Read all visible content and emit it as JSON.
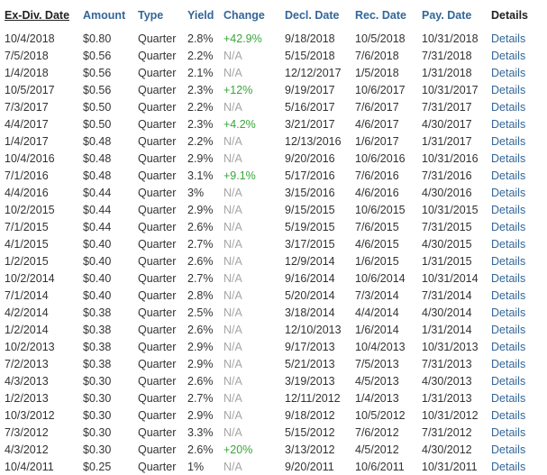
{
  "headers": {
    "ex_date": "Ex-Div. Date",
    "amount": "Amount",
    "type": "Type",
    "yield": "Yield",
    "change": "Change",
    "decl_date": "Decl. Date",
    "rec_date": "Rec. Date",
    "pay_date": "Pay. Date",
    "details": "Details"
  },
  "rows": [
    {
      "ex_date": "10/4/2018",
      "amount": "$0.80",
      "type": "Quarter",
      "yield": "2.8%",
      "change": "+42.9%",
      "decl_date": "9/18/2018",
      "rec_date": "10/5/2018",
      "pay_date": "10/31/2018",
      "details": "Details"
    },
    {
      "ex_date": "7/5/2018",
      "amount": "$0.56",
      "type": "Quarter",
      "yield": "2.2%",
      "change": "N/A",
      "decl_date": "5/15/2018",
      "rec_date": "7/6/2018",
      "pay_date": "7/31/2018",
      "details": "Details"
    },
    {
      "ex_date": "1/4/2018",
      "amount": "$0.56",
      "type": "Quarter",
      "yield": "2.1%",
      "change": "N/A",
      "decl_date": "12/12/2017",
      "rec_date": "1/5/2018",
      "pay_date": "1/31/2018",
      "details": "Details"
    },
    {
      "ex_date": "10/5/2017",
      "amount": "$0.56",
      "type": "Quarter",
      "yield": "2.3%",
      "change": "+12%",
      "decl_date": "9/19/2017",
      "rec_date": "10/6/2017",
      "pay_date": "10/31/2017",
      "details": "Details"
    },
    {
      "ex_date": "7/3/2017",
      "amount": "$0.50",
      "type": "Quarter",
      "yield": "2.2%",
      "change": "N/A",
      "decl_date": "5/16/2017",
      "rec_date": "7/6/2017",
      "pay_date": "7/31/2017",
      "details": "Details"
    },
    {
      "ex_date": "4/4/2017",
      "amount": "$0.50",
      "type": "Quarter",
      "yield": "2.3%",
      "change": "+4.2%",
      "decl_date": "3/21/2017",
      "rec_date": "4/6/2017",
      "pay_date": "4/30/2017",
      "details": "Details"
    },
    {
      "ex_date": "1/4/2017",
      "amount": "$0.48",
      "type": "Quarter",
      "yield": "2.2%",
      "change": "N/A",
      "decl_date": "12/13/2016",
      "rec_date": "1/6/2017",
      "pay_date": "1/31/2017",
      "details": "Details"
    },
    {
      "ex_date": "10/4/2016",
      "amount": "$0.48",
      "type": "Quarter",
      "yield": "2.9%",
      "change": "N/A",
      "decl_date": "9/20/2016",
      "rec_date": "10/6/2016",
      "pay_date": "10/31/2016",
      "details": "Details"
    },
    {
      "ex_date": "7/1/2016",
      "amount": "$0.48",
      "type": "Quarter",
      "yield": "3.1%",
      "change": "+9.1%",
      "decl_date": "5/17/2016",
      "rec_date": "7/6/2016",
      "pay_date": "7/31/2016",
      "details": "Details"
    },
    {
      "ex_date": "4/4/2016",
      "amount": "$0.44",
      "type": "Quarter",
      "yield": "3%",
      "change": "N/A",
      "decl_date": "3/15/2016",
      "rec_date": "4/6/2016",
      "pay_date": "4/30/2016",
      "details": "Details"
    },
    {
      "ex_date": "10/2/2015",
      "amount": "$0.44",
      "type": "Quarter",
      "yield": "2.9%",
      "change": "N/A",
      "decl_date": "9/15/2015",
      "rec_date": "10/6/2015",
      "pay_date": "10/31/2015",
      "details": "Details"
    },
    {
      "ex_date": "7/1/2015",
      "amount": "$0.44",
      "type": "Quarter",
      "yield": "2.6%",
      "change": "N/A",
      "decl_date": "5/19/2015",
      "rec_date": "7/6/2015",
      "pay_date": "7/31/2015",
      "details": "Details"
    },
    {
      "ex_date": "4/1/2015",
      "amount": "$0.40",
      "type": "Quarter",
      "yield": "2.7%",
      "change": "N/A",
      "decl_date": "3/17/2015",
      "rec_date": "4/6/2015",
      "pay_date": "4/30/2015",
      "details": "Details"
    },
    {
      "ex_date": "1/2/2015",
      "amount": "$0.40",
      "type": "Quarter",
      "yield": "2.6%",
      "change": "N/A",
      "decl_date": "12/9/2014",
      "rec_date": "1/6/2015",
      "pay_date": "1/31/2015",
      "details": "Details"
    },
    {
      "ex_date": "10/2/2014",
      "amount": "$0.40",
      "type": "Quarter",
      "yield": "2.7%",
      "change": "N/A",
      "decl_date": "9/16/2014",
      "rec_date": "10/6/2014",
      "pay_date": "10/31/2014",
      "details": "Details"
    },
    {
      "ex_date": "7/1/2014",
      "amount": "$0.40",
      "type": "Quarter",
      "yield": "2.8%",
      "change": "N/A",
      "decl_date": "5/20/2014",
      "rec_date": "7/3/2014",
      "pay_date": "7/31/2014",
      "details": "Details"
    },
    {
      "ex_date": "4/2/2014",
      "amount": "$0.38",
      "type": "Quarter",
      "yield": "2.5%",
      "change": "N/A",
      "decl_date": "3/18/2014",
      "rec_date": "4/4/2014",
      "pay_date": "4/30/2014",
      "details": "Details"
    },
    {
      "ex_date": "1/2/2014",
      "amount": "$0.38",
      "type": "Quarter",
      "yield": "2.6%",
      "change": "N/A",
      "decl_date": "12/10/2013",
      "rec_date": "1/6/2014",
      "pay_date": "1/31/2014",
      "details": "Details"
    },
    {
      "ex_date": "10/2/2013",
      "amount": "$0.38",
      "type": "Quarter",
      "yield": "2.9%",
      "change": "N/A",
      "decl_date": "9/17/2013",
      "rec_date": "10/4/2013",
      "pay_date": "10/31/2013",
      "details": "Details"
    },
    {
      "ex_date": "7/2/2013",
      "amount": "$0.38",
      "type": "Quarter",
      "yield": "2.9%",
      "change": "N/A",
      "decl_date": "5/21/2013",
      "rec_date": "7/5/2013",
      "pay_date": "7/31/2013",
      "details": "Details"
    },
    {
      "ex_date": "4/3/2013",
      "amount": "$0.30",
      "type": "Quarter",
      "yield": "2.6%",
      "change": "N/A",
      "decl_date": "3/19/2013",
      "rec_date": "4/5/2013",
      "pay_date": "4/30/2013",
      "details": "Details"
    },
    {
      "ex_date": "1/2/2013",
      "amount": "$0.30",
      "type": "Quarter",
      "yield": "2.7%",
      "change": "N/A",
      "decl_date": "12/11/2012",
      "rec_date": "1/4/2013",
      "pay_date": "1/31/2013",
      "details": "Details"
    },
    {
      "ex_date": "10/3/2012",
      "amount": "$0.30",
      "type": "Quarter",
      "yield": "2.9%",
      "change": "N/A",
      "decl_date": "9/18/2012",
      "rec_date": "10/5/2012",
      "pay_date": "10/31/2012",
      "details": "Details"
    },
    {
      "ex_date": "7/3/2012",
      "amount": "$0.30",
      "type": "Quarter",
      "yield": "3.3%",
      "change": "N/A",
      "decl_date": "5/15/2012",
      "rec_date": "7/6/2012",
      "pay_date": "7/31/2012",
      "details": "Details"
    },
    {
      "ex_date": "4/3/2012",
      "amount": "$0.30",
      "type": "Quarter",
      "yield": "2.6%",
      "change": "+20%",
      "decl_date": "3/13/2012",
      "rec_date": "4/5/2012",
      "pay_date": "4/30/2012",
      "details": "Details"
    },
    {
      "ex_date": "10/4/2011",
      "amount": "$0.25",
      "type": "Quarter",
      "yield": "1%",
      "change": "N/A",
      "decl_date": "9/20/2011",
      "rec_date": "10/6/2011",
      "pay_date": "10/31/2011",
      "details": "Details"
    }
  ],
  "colors": {
    "header_link": "#336699",
    "header_sorted": "#222222",
    "body_text": "#333333",
    "na_text": "#a5a5a5",
    "positive_change": "#3aa53a",
    "details_link": "#336699"
  }
}
